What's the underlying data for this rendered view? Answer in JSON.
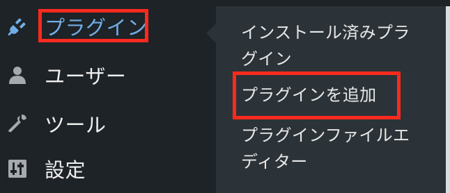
{
  "menu": {
    "items": [
      {
        "label": "プラグイン",
        "icon": "plugin-icon",
        "active": true
      },
      {
        "label": "ユーザー",
        "icon": "user-icon",
        "active": false
      },
      {
        "label": "ツール",
        "icon": "wrench-icon",
        "active": false
      },
      {
        "label": "設定",
        "icon": "settings-sliders-icon",
        "active": false
      }
    ]
  },
  "submenu": {
    "items": [
      {
        "line1": "インストール済みプラ",
        "line2": "グイン"
      },
      {
        "line1": "プラグインを追加",
        "line2": ""
      },
      {
        "line1": "プラグインファイルエ",
        "line2": "ディター"
      }
    ]
  },
  "colors": {
    "sidebar_bg": "#1d2327",
    "submenu_bg": "#2c3338",
    "active_text": "#72aee6",
    "highlight_border": "#ff2a1f"
  }
}
